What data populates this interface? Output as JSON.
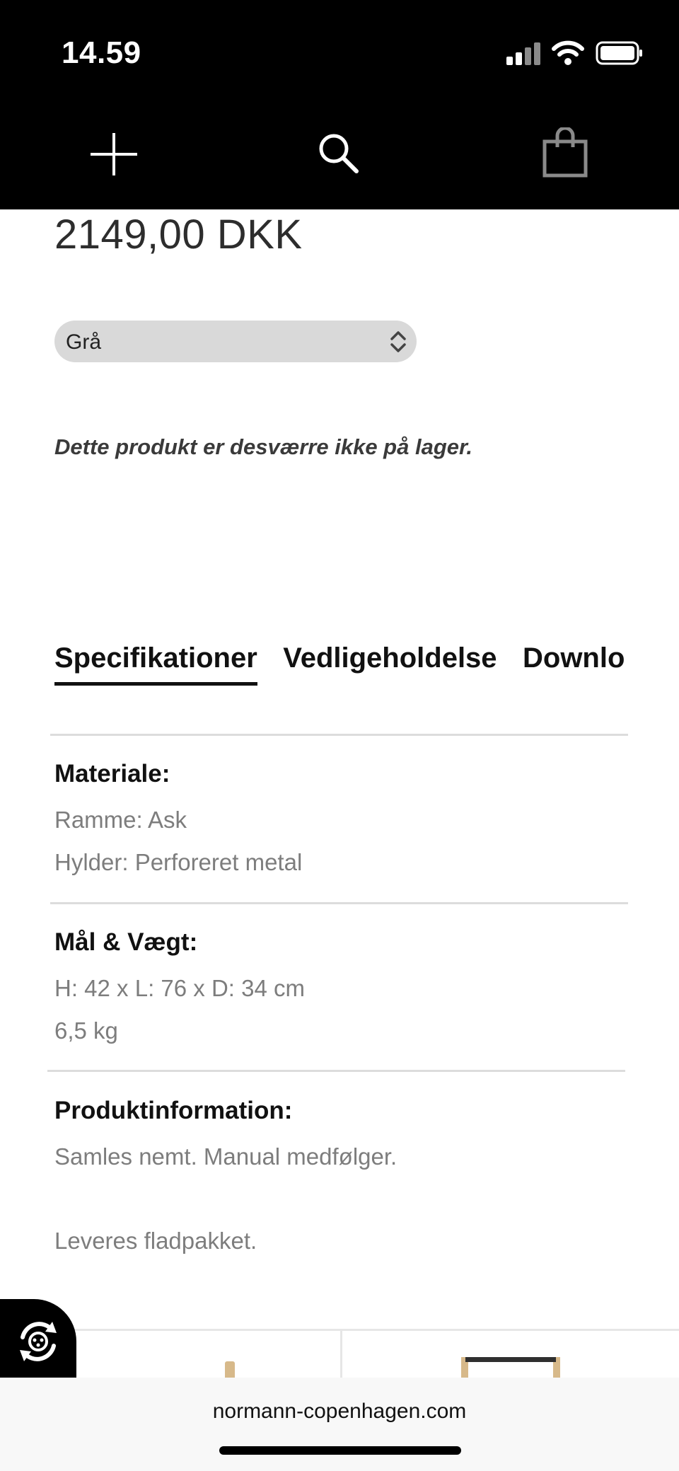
{
  "status_bar": {
    "time": "14.59"
  },
  "nav": {
    "menu_icon": "plus-cross-icon",
    "search_icon": "search-icon",
    "bag_icon": "shopping-bag-icon"
  },
  "product": {
    "price": "2149,00 DKK",
    "variant_select": {
      "value": "Grå"
    },
    "stock_note": "Dette produkt er desværre ikke på lager."
  },
  "tabs": [
    {
      "label": "Specifikationer",
      "active": true
    },
    {
      "label": "Vedligeholdelse",
      "active": false
    },
    {
      "label": "Download",
      "active": false
    }
  ],
  "specs": [
    {
      "title": "Materiale:",
      "lines": [
        "Ramme: Ask",
        "Hylder: Perforeret metal"
      ]
    },
    {
      "title": "Mål & Vægt:",
      "lines": [
        "H: 42 x L: 76 x D: 34 cm",
        "6,5 kg"
      ]
    },
    {
      "title": "Produktinformation:",
      "lines": [
        "Samles nemt. Manual medfølger.",
        "Leveres fladpakket."
      ]
    }
  ],
  "floating_button_icon": "chat-support-icon",
  "browser": {
    "url": "normann-copenhagen.com"
  },
  "colors": {
    "topbar": "#000000",
    "select_bg": "#d9d9d9",
    "spec_text": "#7d7d7d"
  }
}
